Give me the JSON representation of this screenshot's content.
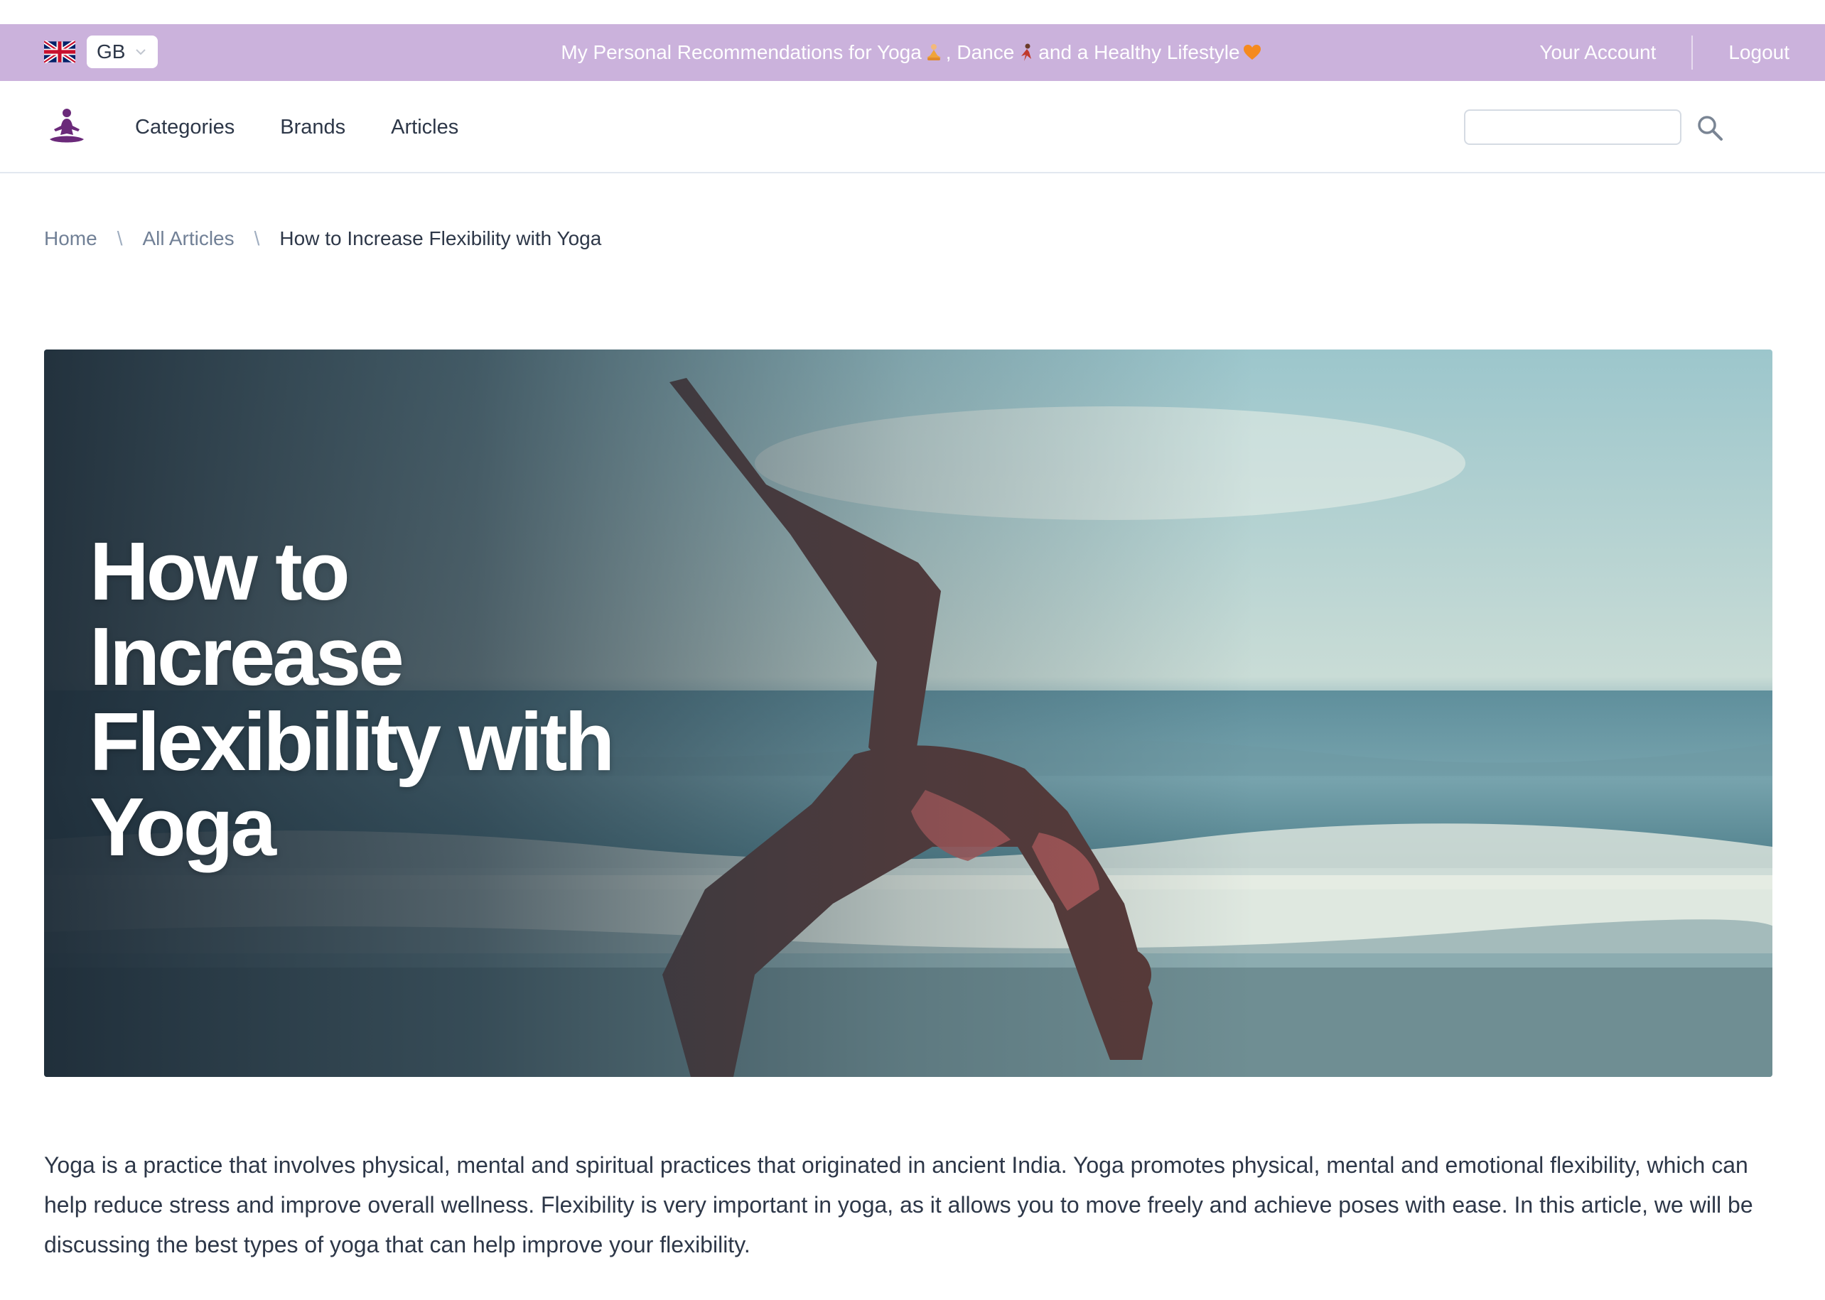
{
  "topbar": {
    "country": "GB",
    "promo_part1": "My Personal Recommendations for Yoga",
    "promo_part2": ", Dance",
    "promo_part3": "and a Healthy Lifestyle",
    "account_label": "Your Account",
    "logout_label": "Logout",
    "background_color": "#cbb2dc"
  },
  "nav": {
    "links": [
      "Categories",
      "Brands",
      "Articles"
    ],
    "search_placeholder": "",
    "logo_color": "#6b2a7a"
  },
  "breadcrumb": {
    "home": "Home",
    "all_articles": "All Articles",
    "current": "How to Increase Flexibility with Yoga",
    "separator": "\\"
  },
  "hero": {
    "title": "How to Increase Flexibility with Yoga"
  },
  "article": {
    "intro": "Yoga is a practice that involves physical, mental and spiritual practices that originated in ancient India. Yoga promotes physical, mental and emotional flexibility, which can help reduce stress and improve overall wellness. Flexibility is very important in yoga, as it allows you to move freely and achieve poses with ease. In this article, we will be discussing the best types of yoga that can help improve your flexibility."
  }
}
